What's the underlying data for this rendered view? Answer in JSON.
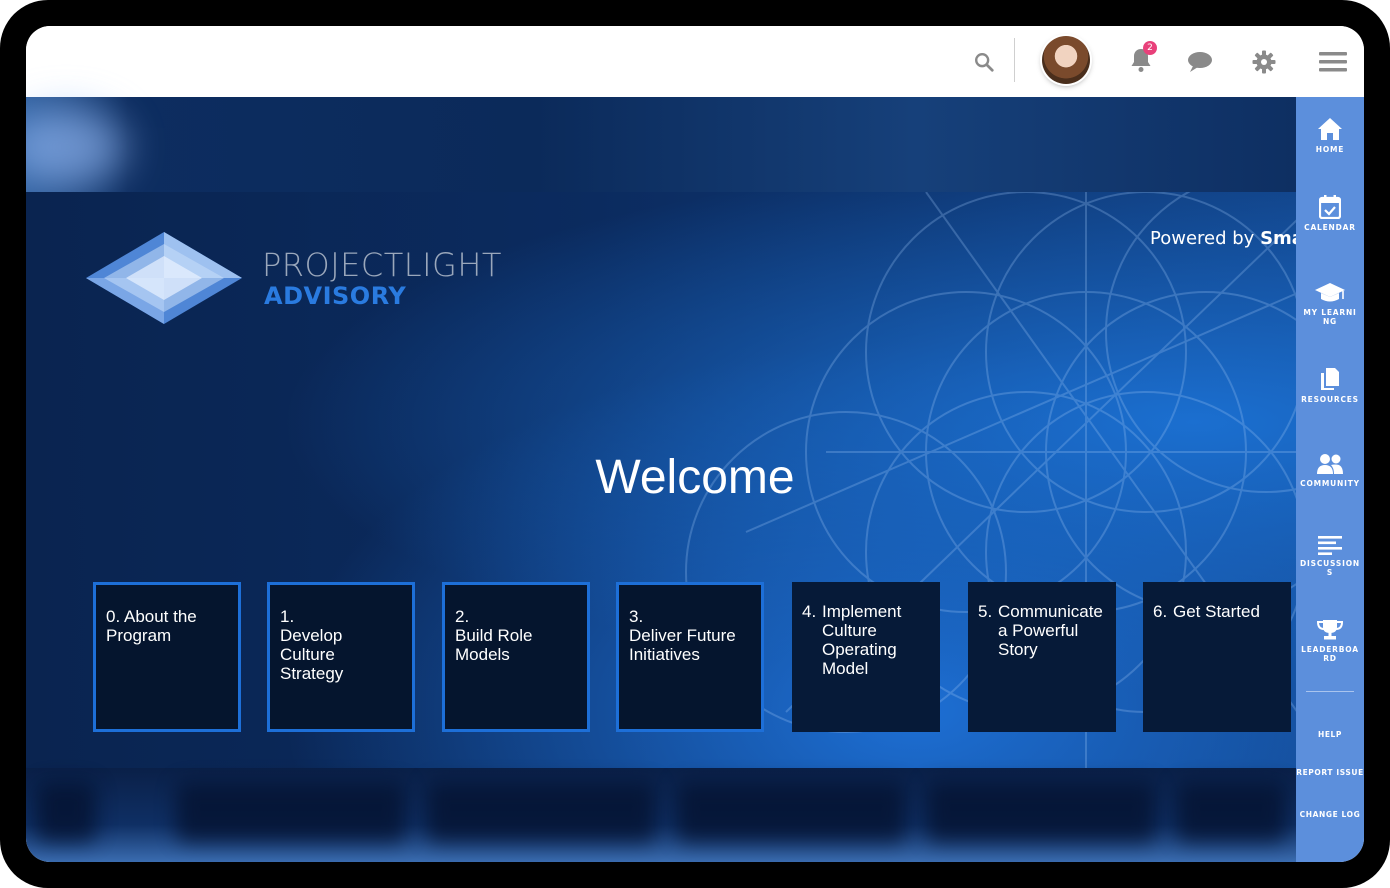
{
  "topbar": {
    "search_icon": "search-icon",
    "notifications_count": "2",
    "icons": [
      "search-icon",
      "bell-icon",
      "chat-icon",
      "gear-icon",
      "menu-icon"
    ]
  },
  "brand": {
    "name_line1": "PROJECTLIGHT",
    "name_line2": "ADVISORY",
    "powered_prefix": "Powered by",
    "powered_name": "Smar"
  },
  "hero": {
    "welcome": "Welcome"
  },
  "cards": [
    {
      "num": "0.",
      "label": "About the Program"
    },
    {
      "num": "1.",
      "label": "Develop Culture Strategy"
    },
    {
      "num": "2.",
      "label": "Build Role Models"
    },
    {
      "num": "3.",
      "label": "Deliver Future Initiatives"
    },
    {
      "num": "4.",
      "label": "Implement Culture Operating Model"
    },
    {
      "num": "5.",
      "label": "Communicate a Powerful Story"
    },
    {
      "num": "6.",
      "label": "Get Started"
    }
  ],
  "sidebar": {
    "items": [
      {
        "label": "HOME",
        "icon": "home-icon"
      },
      {
        "label": "CALENDAR",
        "icon": "calendar-icon"
      },
      {
        "label": "MY LEARNING",
        "icon": "graduation-cap-icon"
      },
      {
        "label": "RESOURCES",
        "icon": "documents-icon"
      },
      {
        "label": "COMMUNITY",
        "icon": "people-icon"
      },
      {
        "label": "DISCUSSIONS",
        "icon": "lines-icon"
      },
      {
        "label": "LEADERBOARD",
        "icon": "trophy-icon"
      }
    ],
    "links": [
      "HELP",
      "REPORT ISSUE",
      "CHANGE LOG"
    ]
  },
  "colors": {
    "sidebar": "#5c8fdc",
    "card_border": "#1d6fd8",
    "accent_text": "#2a7be0",
    "badge": "#e8407a"
  }
}
